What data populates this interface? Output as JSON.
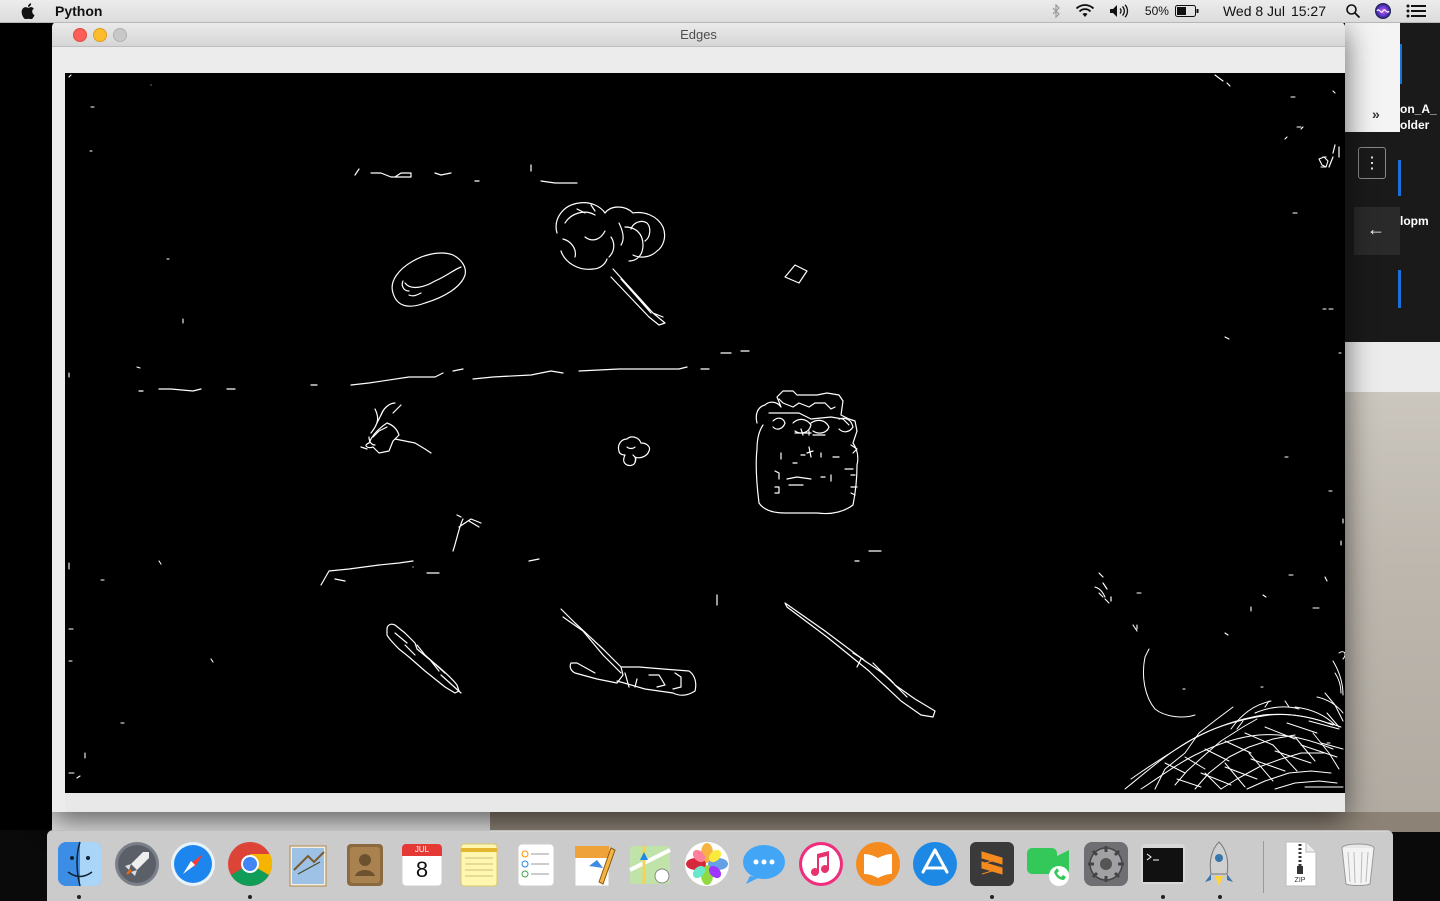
{
  "menubar": {
    "app_name": "Python",
    "battery_percent": "50%",
    "date": "Wed 8 Jul",
    "time": "15:27",
    "icons": [
      "apple-icon",
      "bluetooth-icon",
      "wifi-icon",
      "volume-icon",
      "battery-icon",
      "spotlight-icon",
      "siri-icon",
      "notification-center-icon"
    ]
  },
  "window": {
    "title": "Edges",
    "buttons": [
      "close",
      "minimize",
      "zoom"
    ]
  },
  "background_right": {
    "text_line1": "on_A_",
    "text_line2": "older",
    "text_line3": "lopm",
    "chevron": "»",
    "menu_dots": "⋮",
    "back_arrow": "←"
  },
  "dock": {
    "items": [
      {
        "name": "Finder",
        "icon": "finder-icon",
        "running": true
      },
      {
        "name": "Launchpad",
        "icon": "launchpad-icon",
        "running": false
      },
      {
        "name": "Safari",
        "icon": "safari-icon",
        "running": false
      },
      {
        "name": "Google Chrome",
        "icon": "chrome-icon",
        "running": true
      },
      {
        "name": "Mail",
        "icon": "mail-icon",
        "running": false
      },
      {
        "name": "Contacts",
        "icon": "contacts-icon",
        "running": false
      },
      {
        "name": "Calendar",
        "icon": "calendar-icon",
        "running": false,
        "month": "JUL",
        "day": "8"
      },
      {
        "name": "Notes",
        "icon": "notes-icon",
        "running": false
      },
      {
        "name": "Reminders",
        "icon": "reminders-icon",
        "running": false
      },
      {
        "name": "Pages",
        "icon": "pages-icon",
        "running": false
      },
      {
        "name": "Maps",
        "icon": "maps-icon",
        "running": false
      },
      {
        "name": "Photos",
        "icon": "photos-icon",
        "running": false
      },
      {
        "name": "Messages",
        "icon": "messages-icon",
        "running": false
      },
      {
        "name": "iTunes",
        "icon": "itunes-icon",
        "running": false
      },
      {
        "name": "iBooks",
        "icon": "ibooks-icon",
        "running": false
      },
      {
        "name": "App Store",
        "icon": "app-store-icon",
        "running": false
      },
      {
        "name": "Sublime Text",
        "icon": "sublime-text-icon",
        "running": true
      },
      {
        "name": "FaceTime",
        "icon": "facetime-icon",
        "running": false
      },
      {
        "name": "System Preferences",
        "icon": "system-preferences-icon",
        "running": false
      },
      {
        "name": "Terminal",
        "icon": "terminal-icon",
        "running": true
      },
      {
        "name": "Python Launcher",
        "icon": "python-rocket-icon",
        "running": true
      },
      {
        "name": "Archive",
        "icon": "zip-archive-icon",
        "running": false,
        "label": "ZIP"
      },
      {
        "name": "Trash",
        "icon": "trash-icon",
        "running": false
      }
    ]
  }
}
